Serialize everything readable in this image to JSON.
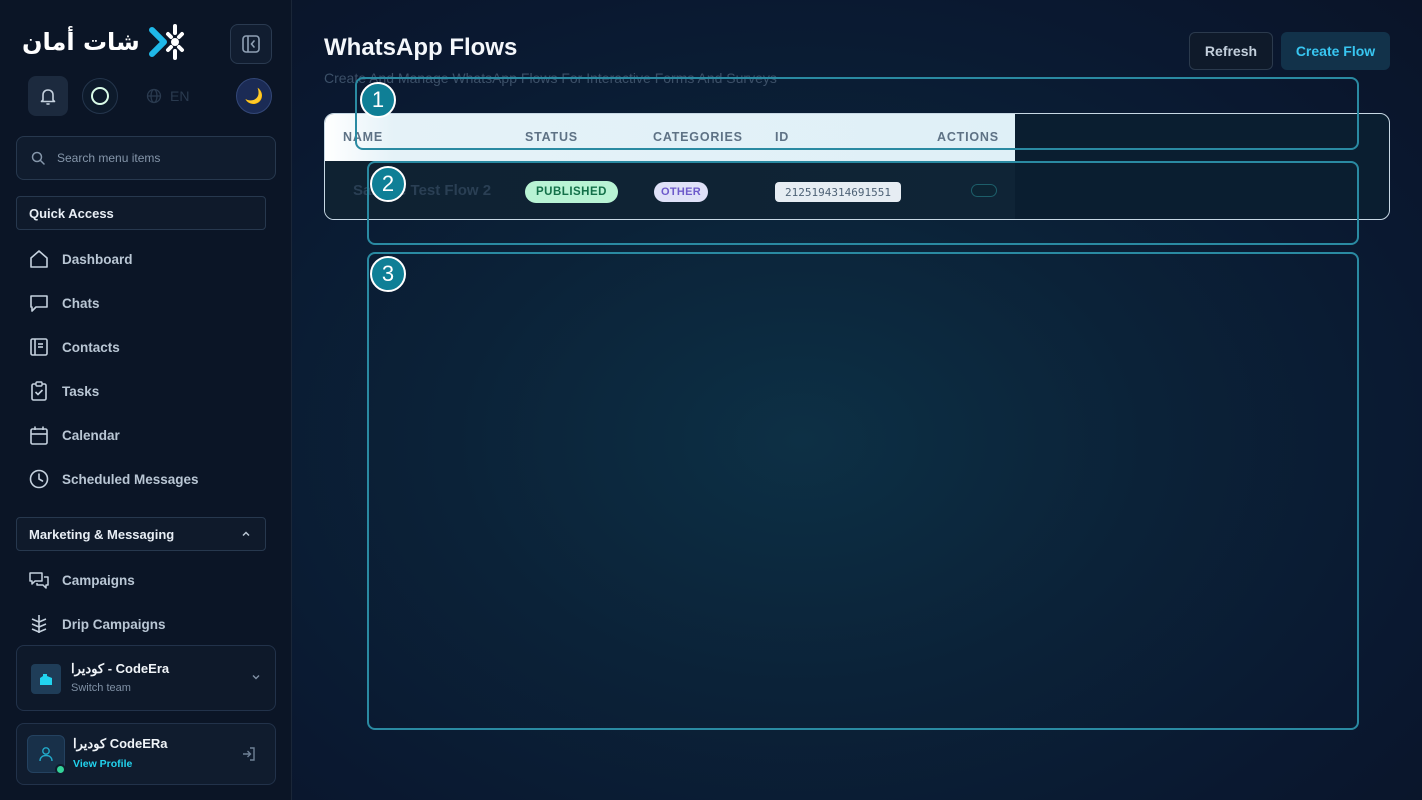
{
  "brand": {
    "logo_text": "شات أمان"
  },
  "toolbar": {
    "lang": "EN"
  },
  "search": {
    "placeholder": "Search menu items"
  },
  "sections": {
    "quick_access": "Quick Access",
    "marketing": "Marketing & Messaging"
  },
  "nav": {
    "quick": [
      {
        "label": "Dashboard",
        "icon": "home-icon"
      },
      {
        "label": "Chats",
        "icon": "chat-icon"
      },
      {
        "label": "Contacts",
        "icon": "contacts-icon"
      },
      {
        "label": "Tasks",
        "icon": "clipboard-icon"
      },
      {
        "label": "Calendar",
        "icon": "calendar-icon"
      },
      {
        "label": "Scheduled Messages",
        "icon": "clock-icon"
      }
    ],
    "marketing": [
      {
        "label": "Campaigns",
        "icon": "campaign-icon"
      },
      {
        "label": "Drip Campaigns",
        "icon": "drip-icon"
      }
    ]
  },
  "team": {
    "name": "كوديرا - CodeEra",
    "sub": "Switch team"
  },
  "user": {
    "name": "كوديرا CodeERa",
    "link": "View Profile"
  },
  "page": {
    "title": "WhatsApp Flows",
    "subtitle": "Create And Manage WhatsApp Flows For Interactive Forms And Surveys",
    "refresh": "Refresh",
    "create": "Create Flow"
  },
  "table": {
    "headers": {
      "name": "NAME",
      "status": "STATUS",
      "categories": "CATEGORIES",
      "id": "ID",
      "actions": "ACTIONS"
    },
    "rows": [
      {
        "name": "Sample Test Flow 2",
        "status": "PUBLISHED",
        "category": "OTHER",
        "id": "2125194314691551"
      }
    ]
  },
  "annotations": [
    "1",
    "2",
    "3"
  ],
  "colors": {
    "accent": "#22d3ee",
    "published_bg": "#b8f3d4",
    "other_bg": "#dfe1f8",
    "annotation": "#0f7f96"
  }
}
